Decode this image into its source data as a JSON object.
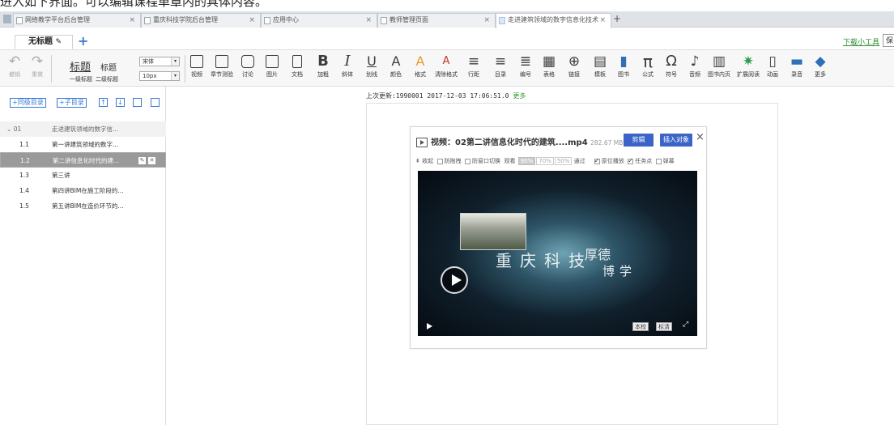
{
  "top_text": "进入如下界面。可以编辑课程单章内的具体内容。",
  "browser": {
    "tabs": [
      {
        "label": "网络教学平台后台管理"
      },
      {
        "label": "重庆科技学院后台管理"
      },
      {
        "label": "应用中心"
      },
      {
        "label": "教师管理页面"
      },
      {
        "label": "走进建筑领域的数字信息化技术"
      }
    ],
    "close_glyph": "×",
    "new_tab": "+"
  },
  "doc": {
    "tab_label": "无标题",
    "edit_glyph": "✎",
    "add_glyph": "+",
    "download_link": "下载小工具",
    "right_box": "保"
  },
  "toolbar": {
    "undo": "撤销",
    "redo": "重做",
    "heading1": "标题",
    "heading2": "标题",
    "heading1_sub": "一级标题",
    "heading2_sub": "二级标题",
    "font_family": "宋体",
    "font_size": "10px",
    "items": [
      {
        "icon": "video-icon",
        "label": "视频"
      },
      {
        "icon": "quiz-icon",
        "label": "章节测验"
      },
      {
        "icon": "discuss-icon",
        "label": "讨论"
      },
      {
        "icon": "image-icon",
        "label": "图片"
      },
      {
        "icon": "doc-icon",
        "label": "文档"
      },
      {
        "icon": "bold-icon",
        "glyph": "B",
        "label": "加粗"
      },
      {
        "icon": "italic-icon",
        "glyph": "I",
        "label": "斜体"
      },
      {
        "icon": "underline-icon",
        "glyph": "U",
        "label": "划线"
      },
      {
        "icon": "color-icon",
        "glyph": "A",
        "label": "颜色"
      },
      {
        "icon": "format-icon",
        "glyph": "A",
        "label": "格式"
      },
      {
        "icon": "clear-format-icon",
        "glyph": "A",
        "label": "清除格式"
      },
      {
        "icon": "line-spacing-icon",
        "glyph": "≡",
        "label": "行距"
      },
      {
        "icon": "toc-icon",
        "glyph": "≡",
        "label": "目录"
      },
      {
        "icon": "numbering-icon",
        "glyph": "≣",
        "label": "编号"
      },
      {
        "icon": "table-icon",
        "glyph": "▦",
        "label": "表格"
      },
      {
        "icon": "link-icon",
        "glyph": "⊕",
        "label": "链接"
      },
      {
        "icon": "template-icon",
        "glyph": "▤",
        "label": "模板"
      },
      {
        "icon": "book-icon",
        "glyph": "▮",
        "label": "图书"
      },
      {
        "icon": "formula-icon",
        "glyph": "π",
        "label": "公式"
      },
      {
        "icon": "symbol-icon",
        "glyph": "Ω",
        "label": "符号"
      },
      {
        "icon": "audio-icon",
        "glyph": "♪",
        "label": "音频"
      },
      {
        "icon": "book-page-icon",
        "glyph": "▥",
        "label": "图书内页"
      },
      {
        "icon": "extended-reading-icon",
        "glyph": "✷",
        "label": "扩展阅读"
      },
      {
        "icon": "animation-icon",
        "glyph": "▯",
        "label": "动画"
      },
      {
        "icon": "record-icon",
        "glyph": "▬",
        "label": "录音"
      },
      {
        "icon": "more-icon",
        "glyph": "◆",
        "label": "更多"
      }
    ]
  },
  "sidebar": {
    "btn_same_level": "+同级目录",
    "btn_child": "+子目录",
    "btn_up": "↑",
    "btn_down": "↓",
    "chapter": {
      "num": "01",
      "title": "走进建筑领域的数字信..."
    },
    "sections": [
      {
        "num": "1.1",
        "title": "第一讲建筑领域的数字..."
      },
      {
        "num": "1.2",
        "title": "第二讲信息化时代的建..."
      },
      {
        "num": "1.3",
        "title": "第三讲"
      },
      {
        "num": "1.4",
        "title": "第四讲BIM在施工阶段的..."
      },
      {
        "num": "1.5",
        "title": "第五讲BIM在造价环节的..."
      }
    ]
  },
  "content": {
    "last_update": "上次更新:1990001 2017-12-03 17:06:51.0",
    "more": "更多"
  },
  "video_card": {
    "title_prefix": "视频：02第二讲信息化时代的建筑....mp4",
    "size": "282.67 MB",
    "btn_clip": "剪辑",
    "btn_insert": "插入对象",
    "close": "×",
    "collapse": "收起",
    "opt_anti_drag": "防拖拽",
    "opt_anti_switch": "防窗口切换",
    "watch_label": "观看",
    "pcts": [
      "90%",
      "70%",
      "50%"
    ],
    "pass_label": "通过",
    "opt_inplace": "原位播放",
    "opt_task": "任务点",
    "opt_barrage": "弹幕",
    "video_text_1": "重庆科技",
    "video_text_2": "厚德",
    "video_text_3": "博学",
    "btn_school": "本校",
    "btn_sd": "标清"
  }
}
